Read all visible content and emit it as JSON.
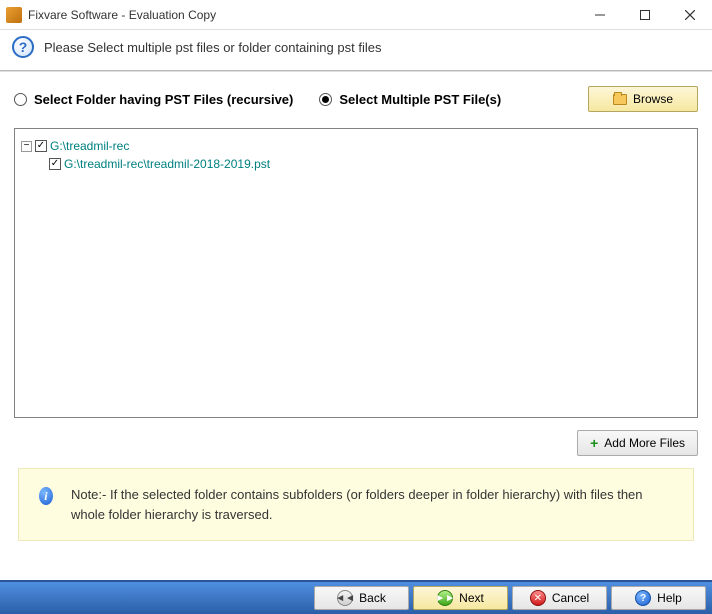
{
  "window": {
    "title": "Fixvare Software - Evaluation Copy"
  },
  "header": {
    "instruction": "Please Select multiple pst files or folder containing pst files"
  },
  "options": {
    "folder_label": "Select Folder having PST Files (recursive)",
    "multi_label": "Select Multiple PST File(s)",
    "browse_label": "Browse"
  },
  "tree": {
    "root": {
      "label": "G:\\treadmil-rec",
      "expanded": true,
      "checked": true
    },
    "child": {
      "label": "G:\\treadmil-rec\\treadmil-2018-2019.pst",
      "checked": true
    }
  },
  "actions": {
    "add_more_label": "Add More Files"
  },
  "note": {
    "text": "Note:- If the selected folder contains subfolders (or folders deeper in folder hierarchy) with files then whole folder hierarchy is traversed."
  },
  "footer": {
    "back": "Back",
    "next": "Next",
    "cancel": "Cancel",
    "help": "Help"
  }
}
